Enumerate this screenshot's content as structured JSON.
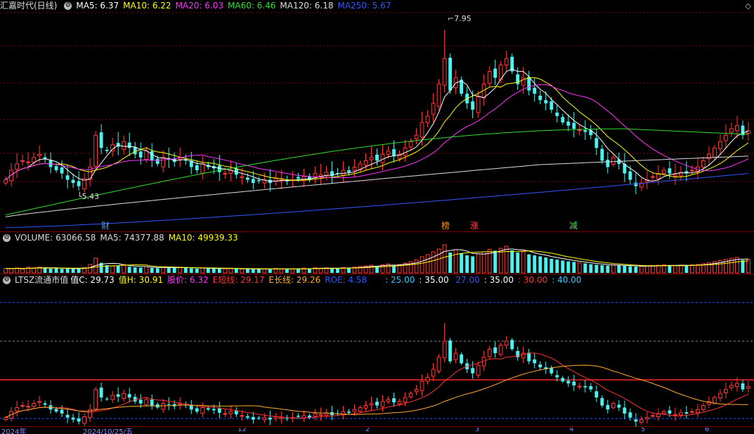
{
  "chart_data": [
    {
      "type": "candlestick",
      "panel": "price",
      "title": "汇嘉时代(日线)",
      "ylim": [
        5.0,
        8.2
      ],
      "legend": [
        {
          "label": "MA5: 6.37",
          "color": "#ffffff"
        },
        {
          "label": "MA10: 6.22",
          "color": "#ffff00"
        },
        {
          "label": "MA20: 6.03",
          "color": "#ff33ff"
        },
        {
          "label": "MA60: 6.46",
          "color": "#33dd33"
        },
        {
          "label": "MA120: 6.18",
          "color": "#dddddd"
        },
        {
          "label": "MA250: 5.67",
          "color": "#3355ff"
        }
      ],
      "annotations": [
        {
          "text": "7.95",
          "at_value": 7.95
        },
        {
          "text": "5.43",
          "at_value": 5.43
        }
      ],
      "markers": [
        {
          "text": "财",
          "color": "#5599ff"
        },
        {
          "text": "榜",
          "color": "#ff9900"
        },
        {
          "text": "涨",
          "color": "#ff4444"
        },
        {
          "text": "减",
          "color": "#55dd55"
        }
      ],
      "close": [
        5.6,
        5.75,
        5.85,
        5.9,
        5.88,
        5.95,
        6.0,
        5.92,
        5.8,
        5.75,
        5.7,
        5.6,
        5.55,
        5.5,
        5.62,
        5.8,
        6.3,
        6.1,
        6.05,
        6.15,
        6.12,
        6.2,
        6.1,
        6.0,
        5.95,
        6.05,
        5.9,
        5.85,
        5.95,
        5.92,
        5.88,
        5.95,
        5.9,
        5.8,
        5.75,
        5.85,
        5.8,
        5.78,
        5.72,
        5.7,
        5.75,
        5.68,
        5.65,
        5.6,
        5.55,
        5.58,
        5.6,
        5.55,
        5.62,
        5.6,
        5.58,
        5.6,
        5.62,
        5.65,
        5.6,
        5.7,
        5.68,
        5.72,
        5.66,
        5.7,
        5.75,
        5.72,
        5.8,
        5.85,
        5.9,
        5.95,
        5.9,
        6.0,
        6.05,
        5.98,
        6.0,
        6.1,
        6.2,
        6.3,
        6.5,
        6.6,
        6.8,
        7.1,
        7.5,
        7.0,
        7.2,
        6.95,
        6.8,
        6.7,
        6.9,
        7.1,
        7.3,
        7.2,
        7.4,
        7.5,
        7.3,
        7.1,
        7.2,
        7.0,
        6.95,
        6.85,
        6.8,
        6.7,
        6.6,
        6.5,
        6.45,
        6.4,
        6.38,
        6.35,
        6.3,
        6.1,
        5.9,
        5.8,
        5.95,
        5.85,
        5.7,
        5.6,
        5.5,
        5.55,
        5.6,
        5.65,
        5.7,
        5.75,
        5.7,
        5.68,
        5.72,
        5.7,
        5.75,
        5.8,
        5.9,
        6.0,
        6.1,
        6.2,
        6.3,
        6.4,
        6.45,
        6.3,
        6.37
      ],
      "volume": {
        "title": "VOLUME: 63066.58",
        "ma5_label": "MA5: 74377.88",
        "ma10_label": "MA10: 49939.33",
        "values": [
          32,
          30,
          35,
          28,
          40,
          36,
          42,
          38,
          30,
          34,
          29,
          31,
          27,
          33,
          38,
          60,
          105,
          72,
          55,
          48,
          52,
          60,
          44,
          40,
          38,
          45,
          36,
          34,
          40,
          38,
          37,
          41,
          36,
          33,
          30,
          35,
          32,
          34,
          30,
          29,
          33,
          31,
          28,
          27,
          26,
          29,
          30,
          27,
          32,
          28,
          26,
          29,
          31,
          34,
          30,
          37,
          33,
          36,
          31,
          34,
          38,
          36,
          42,
          46,
          50,
          55,
          48,
          58,
          64,
          52,
          60,
          70,
          80,
          92,
          115,
          130,
          150,
          170,
          200,
          145,
          165,
          140,
          125,
          118,
          135,
          150,
          168,
          158,
          175,
          190,
          160,
          145,
          150,
          132,
          125,
          118,
          110,
          100,
          95,
          88,
          82,
          78,
          72,
          68,
          62,
          58,
          55,
          52,
          57,
          54,
          50,
          47,
          45,
          48,
          50,
          52,
          55,
          58,
          54,
          52,
          55,
          53,
          57,
          60,
          66,
          72,
          80,
          88,
          96,
          104,
          110,
          92,
          96
        ]
      }
    },
    {
      "type": "candlestick",
      "panel": "indicator",
      "title": "LTSZ流通市值",
      "values": [
        {
          "label": "值C: 29.73",
          "color": "#ffffff"
        },
        {
          "label": "值H: 30.91",
          "color": "#ffff00"
        },
        {
          "label": "股价: 6.32",
          "color": "#ff33ff"
        },
        {
          "label": "E短线: 29.17",
          "color": "#ff3333"
        },
        {
          "label": "E长线: 29.26",
          "color": "#ffaa33"
        },
        {
          "label": "ROE: 4.58",
          "color": "#3355ff"
        },
        {
          "label": ": 25.00",
          "color": "#33ccff"
        },
        {
          "label": ": 35.00",
          "color": "#ffffff"
        },
        {
          "label": " 27.00",
          "color": "#3355ff"
        },
        {
          "label": ": 35.00",
          "color": "#ffffff"
        },
        {
          "label": ": 30.00",
          "color": "#ff3333"
        },
        {
          "label": ": 40.00",
          "color": "#33ccff"
        }
      ],
      "ylim": [
        24,
        42
      ],
      "levels": [
        25,
        30,
        35,
        40
      ]
    }
  ],
  "datebar": {
    "labels": [
      "2024年",
      "2024/10/25/五",
      "12",
      "2",
      "3",
      "4",
      "5",
      "6"
    ]
  }
}
